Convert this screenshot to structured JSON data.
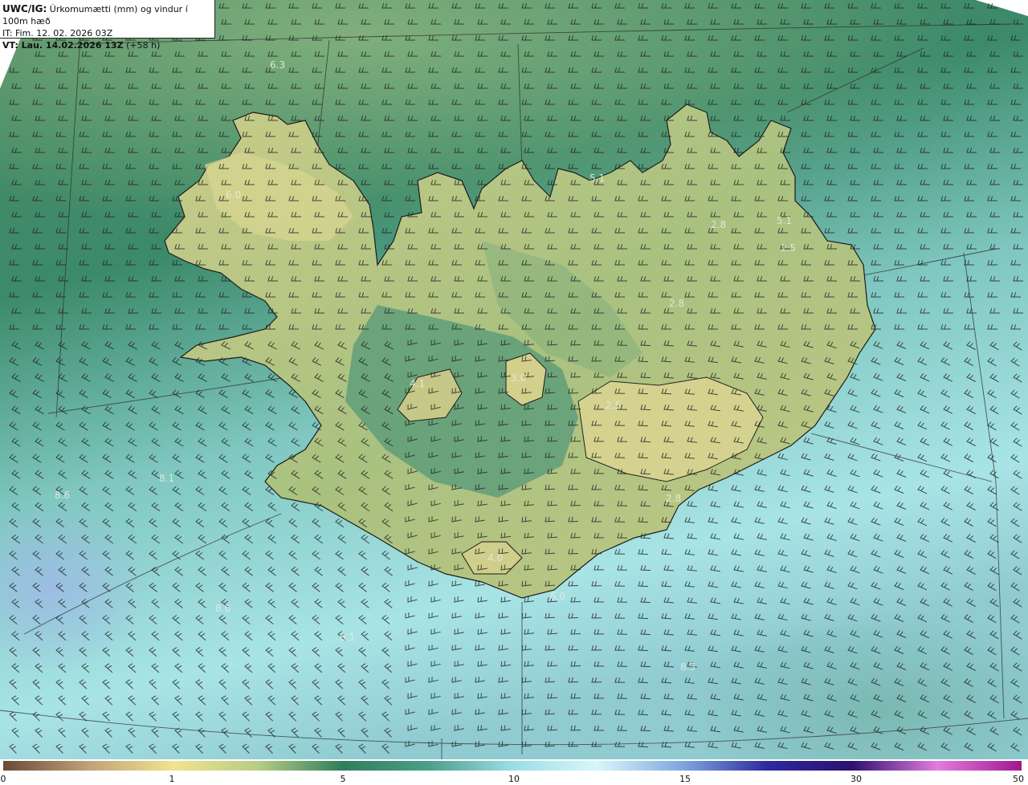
{
  "header": {
    "model": "UWC/IG:",
    "title": "Úrkomumætti (mm) og vindur í 100m hæð",
    "issue_time": "IT: Fim. 12. 02. 2026 03Z",
    "valid_label": "VT: Lau. 14.02.2026 13Z",
    "valid_offset": "(+58 h)"
  },
  "map_labels": [
    {
      "text": "6.3"
    },
    {
      "text": "5.1"
    },
    {
      "text": "2.8"
    },
    {
      "text": "5.1"
    },
    {
      "text": "2.5"
    },
    {
      "text": "2.8"
    },
    {
      "text": "4.1"
    },
    {
      "text": "3.0"
    },
    {
      "text": "2.5"
    },
    {
      "text": "2.8"
    },
    {
      "text": "4.0"
    },
    {
      "text": "6.0"
    },
    {
      "text": "6.1"
    },
    {
      "text": "8.6"
    },
    {
      "text": "8.5"
    },
    {
      "text": "8.1"
    },
    {
      "text": "8.6"
    },
    {
      "text": "6.0"
    }
  ],
  "colorbar": {
    "ticks": [
      "0",
      "1",
      "5",
      "10",
      "15",
      "30",
      "50"
    ],
    "colors": [
      "#6b4a36",
      "#bfa178",
      "#f1e48e",
      "#b8cc85",
      "#2f7e5c",
      "#4c9e89",
      "#9bdde6",
      "#d8f7f8",
      "#7fa7e0",
      "#2d2aa0",
      "#2d1070",
      "#e27be0",
      "#a0188e"
    ]
  },
  "legend_colors": {
    "sea_high": "#b7eef0",
    "sea_low": "#3d8a6a",
    "land_dry": "#d1d08c",
    "coast": "#1c1c1c"
  }
}
